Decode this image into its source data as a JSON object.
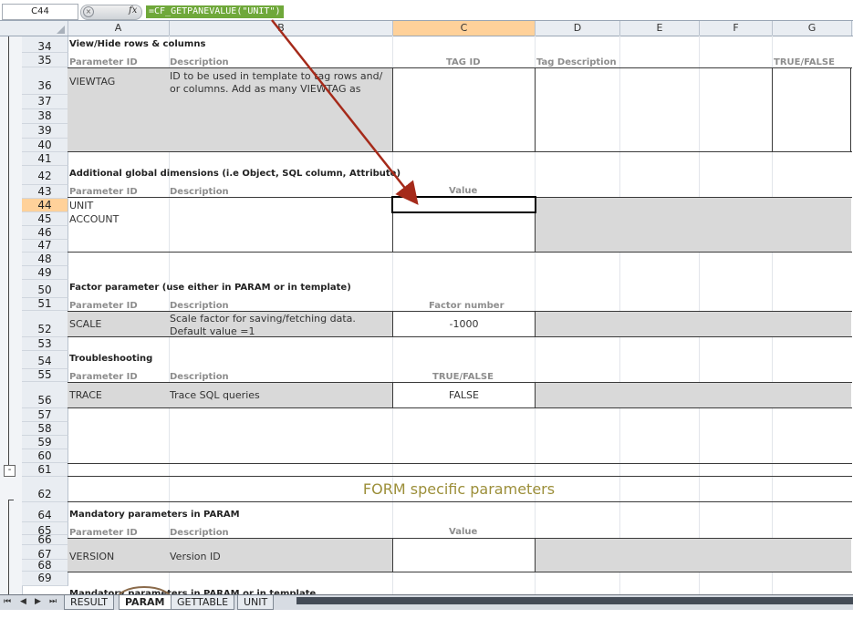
{
  "namebox": "C44",
  "formula": "=CF_GETPANEVALUE(\"UNIT\")",
  "columns": [
    "A",
    "B",
    "C",
    "D",
    "E",
    "F",
    "G"
  ],
  "rows": [
    "34",
    "35",
    "36",
    "37",
    "38",
    "39",
    "40",
    "41",
    "42",
    "43",
    "44",
    "45",
    "46",
    "47",
    "48",
    "49",
    "50",
    "51",
    "52",
    "53",
    "54",
    "55",
    "56",
    "57",
    "58",
    "59",
    "60",
    "61",
    "62",
    "64",
    "65",
    "66",
    "67",
    "68",
    "69"
  ],
  "outline_collapse": "-",
  "sections": {
    "viewhide": {
      "title": "View/Hide rows & columns",
      "param_id": "Parameter ID",
      "description": "Description",
      "tag_id": "TAG ID",
      "tag_desc": "Tag Description",
      "truefalse": "TRUE/FALSE",
      "name": "VIEWTAG",
      "desc1": "ID to be used in template to tag rows and/",
      "desc2": "or columns. Add as many VIEWTAG as"
    },
    "global": {
      "title": "Additional global dimensions (i.e Object, SQL column, Attribute)",
      "param_id": "Parameter ID",
      "description": "Description",
      "value": "Value",
      "item1": "UNIT",
      "item2": "ACCOUNT"
    },
    "factor": {
      "title": "Factor parameter (use either in PARAM or in template)",
      "param_id": "Parameter ID",
      "description": "Description",
      "factor_number": "Factor number",
      "name": "SCALE",
      "desc1": "Scale factor for saving/fetching data.",
      "desc2": "Default value =1",
      "value": "-1000"
    },
    "trouble": {
      "title": "Troubleshooting",
      "param_id": "Parameter ID",
      "description": "Description",
      "truefalse": "TRUE/FALSE",
      "name": "TRACE",
      "desc": "Trace SQL queries",
      "value": "FALSE"
    },
    "form": {
      "title": "FORM specific parameters"
    },
    "mandatory": {
      "title": "Mandatory parameters in PARAM",
      "param_id": "Parameter ID",
      "description": "Description",
      "value": "Value",
      "name": "VERSION",
      "desc": "Version ID"
    },
    "partial": {
      "title": "Mandatory parameters in PARAM or in template"
    }
  },
  "tabs": [
    "RESULT",
    "PARAM",
    "GETTABLE",
    "UNIT"
  ],
  "nav": [
    "⏮",
    "◀",
    "▶",
    "⏭"
  ],
  "colors": {
    "selection_header": "#ffd19a",
    "formula_highlight": "#6fa83a",
    "arrow": "#a52a1a",
    "gray_fill": "#d9d9d9",
    "title_olive": "#9c8f3a"
  }
}
